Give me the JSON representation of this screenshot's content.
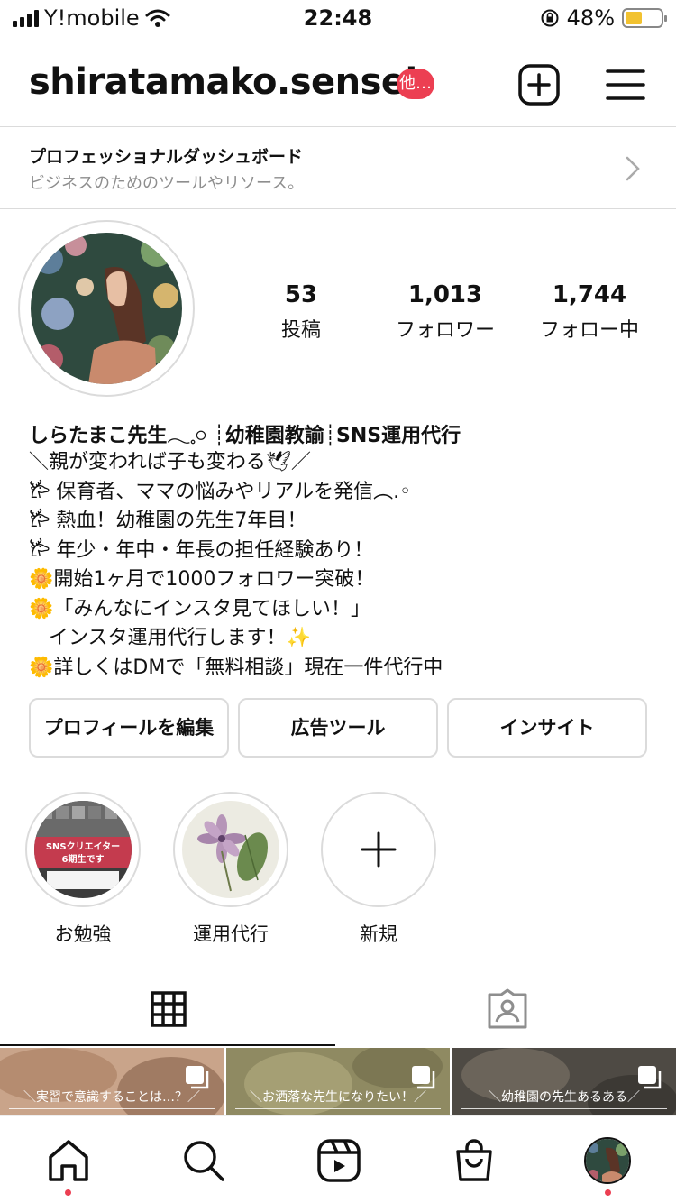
{
  "status_bar": {
    "carrier": "Y!mobile",
    "time": "22:48",
    "battery": "48%",
    "battery_level": 0.48
  },
  "header": {
    "username": "shiratamako.sensei",
    "badge": "他…"
  },
  "dashboard": {
    "title": "プロフェッショナルダッシュボード",
    "subtitle": "ビジネスのためのツールやリソース。"
  },
  "stats": [
    {
      "value": "53",
      "label": "投稿"
    },
    {
      "value": "1,013",
      "label": "フォロワー"
    },
    {
      "value": "1,744",
      "label": "フォロー中"
    }
  ],
  "bio": {
    "name": "しらたまこ先生𓂃𓈒𓏸 ┊幼稚園教諭┊SNS運用代行",
    "lines": [
      "＼親が変われば子も変わる🕊／",
      "𐂂 保育者、ママの悩みやリアルを発信︵.◦",
      "𐂂 熱血！幼稚園の先生7年目！",
      "𐂂 年少・年中・年長の担任経験あり！",
      "🌼開始1ヶ月で1000フォロワー突破！",
      "🌼「みんなにインスタ見てほしい！」",
      "　インスタ運用代行します！✨",
      "🌼詳しくはDMで「無料相談」現在一件代行中"
    ]
  },
  "buttons": {
    "edit_profile": "プロフィールを編集",
    "ad_tools": "広告ツール",
    "insights": "インサイト"
  },
  "highlights": [
    {
      "label": "お勉強",
      "cover_text": "SNSクリエイター 6期生です"
    },
    {
      "label": "運用代行"
    },
    {
      "label": "新規"
    }
  ],
  "posts": [
    {
      "caption": "＼実習で意識することは…？／"
    },
    {
      "caption": "＼お洒落な先生になりたい！／"
    },
    {
      "caption": "＼幼稚園の先生あるある／"
    }
  ],
  "tabs": [
    "grid-icon",
    "tagged-icon"
  ],
  "bottom_nav": [
    "home-icon",
    "search-icon",
    "reels-icon",
    "shop-icon",
    "profile-avatar"
  ],
  "colors": {
    "accent": "#ec3f52",
    "border": "#dbdbdb",
    "muted_text": "#8e8e8e"
  }
}
